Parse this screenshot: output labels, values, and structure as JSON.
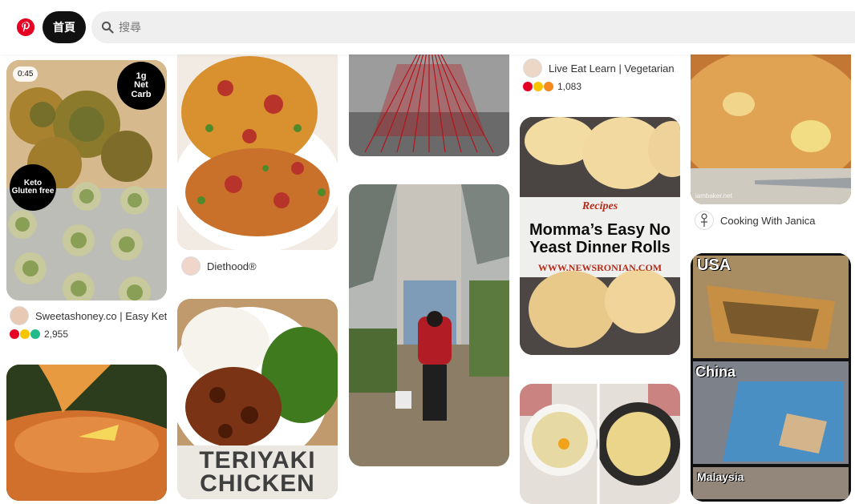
{
  "header": {
    "home_label": "首頁",
    "search_placeholder": "搜尋",
    "brand_color": "#e60023"
  },
  "pins": {
    "keto_balls": {
      "video_time": "0:45",
      "badge_carb": "1g\nNet\nCarb",
      "badge_keto": "Keto\nGluten free",
      "author": "Sweetashoney.co | Easy Ket...",
      "reaction_count": "2,955"
    },
    "salmon": {},
    "baked_chicken": {
      "author": "Diethood®"
    },
    "teriyaki": {
      "overlay_text": "TERIYAKI\nCHICKEN"
    },
    "red_art": {},
    "street_art": {},
    "veg_source": {
      "author": "Live Eat Learn | Vegetarian...",
      "reaction_count": "1,083"
    },
    "rolls": {
      "label_script": "Recipes",
      "title": "Momma’s Easy No\nYeast Dinner Rolls",
      "site": "WWW.NEWSRONIAN.COM"
    },
    "eggs_waffle": {},
    "apple_cake": {
      "watermark": "iambaker.net",
      "author": "Cooking With Janica"
    },
    "street3d": {
      "label_usa": "USA",
      "label_china": "China",
      "label_malaysia": "Malaysia"
    }
  }
}
